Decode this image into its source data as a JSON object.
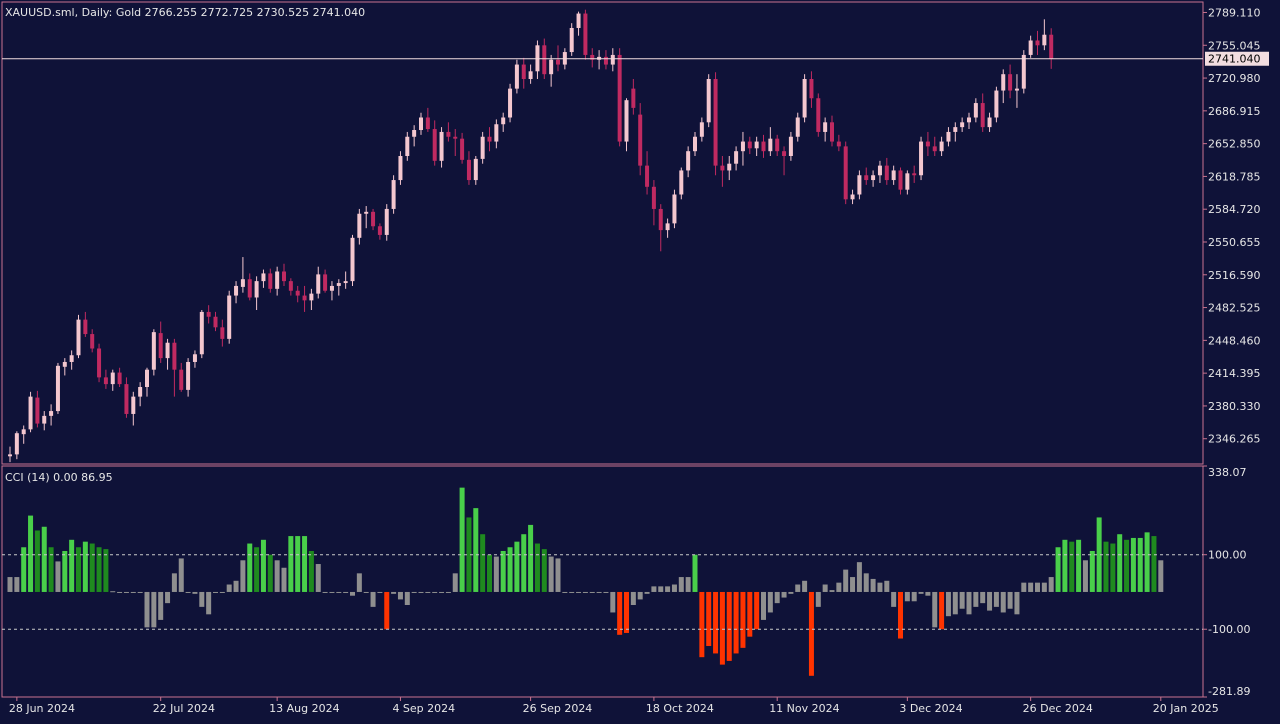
{
  "colors": {
    "background": "#0f1238",
    "border": "#c8738f",
    "bull_candle": "#f4c7cf",
    "bear_candle": "#c02a61",
    "price_line": "#f2dde0",
    "cci_strong_up": "#1f8a1f",
    "cci_up": "#49cf4a",
    "cci_neutral": "#8f8f8f",
    "cci_down": "#ff3300"
  },
  "chart_data": [
    {
      "type": "candlestick",
      "title": "XAUUSD.sml, Daily:  Gold  2766.255 2772.725 2730.525 2741.040",
      "last_price_label": "2741.040",
      "last_price": 2741.04,
      "ylim": [
        2320.0,
        2800.0
      ],
      "y_ticks": [
        "2789.110",
        "2755.045",
        "2720.980",
        "2686.915",
        "2652.850",
        "2618.785",
        "2584.720",
        "2550.655",
        "2516.590",
        "2482.525",
        "2448.460",
        "2414.395",
        "2380.330",
        "2346.265"
      ],
      "candles": [
        [
          2328.0,
          2338.0,
          2322.0,
          2330.0
        ],
        [
          2330.0,
          2354.0,
          2325.0,
          2352.0
        ],
        [
          2351.0,
          2360.0,
          2341.0,
          2356.0
        ],
        [
          2356.0,
          2395.0,
          2353.0,
          2390.0
        ],
        [
          2389.0,
          2396.0,
          2358.0,
          2362.0
        ],
        [
          2362.0,
          2375.0,
          2355.0,
          2370.0
        ],
        [
          2370.0,
          2382.0,
          2360.0,
          2375.0
        ],
        [
          2375.0,
          2425.0,
          2372.0,
          2422.0
        ],
        [
          2421.0,
          2430.0,
          2412.0,
          2426.0
        ],
        [
          2426.0,
          2438.0,
          2418.0,
          2433.0
        ],
        [
          2433.0,
          2475.0,
          2430.0,
          2470.0
        ],
        [
          2470.0,
          2478.0,
          2452.0,
          2455.0
        ],
        [
          2455.0,
          2460.0,
          2436.0,
          2440.0
        ],
        [
          2440.0,
          2445.0,
          2405.0,
          2410.0
        ],
        [
          2410.0,
          2418.0,
          2398.0,
          2403.0
        ],
        [
          2403.0,
          2418.0,
          2396.0,
          2415.0
        ],
        [
          2415.0,
          2420.0,
          2400.0,
          2403.0
        ],
        [
          2403.0,
          2410.0,
          2368.0,
          2372.0
        ],
        [
          2372.0,
          2395.0,
          2360.0,
          2390.0
        ],
        [
          2390.0,
          2405.0,
          2380.0,
          2400.0
        ],
        [
          2400.0,
          2420.0,
          2390.0,
          2418.0
        ],
        [
          2418.0,
          2460.0,
          2412.0,
          2457.0
        ],
        [
          2456.0,
          2468.0,
          2425.0,
          2430.0
        ],
        [
          2430.0,
          2450.0,
          2418.0,
          2446.0
        ],
        [
          2446.0,
          2450.0,
          2390.0,
          2418.0
        ],
        [
          2418.0,
          2425.0,
          2395.0,
          2397.0
        ],
        [
          2397.0,
          2430.0,
          2390.0,
          2426.0
        ],
        [
          2426.0,
          2438.0,
          2420.0,
          2434.0
        ],
        [
          2434.0,
          2480.0,
          2430.0,
          2478.0
        ],
        [
          2478.0,
          2485.0,
          2466.0,
          2473.0
        ],
        [
          2473.0,
          2478.0,
          2458.0,
          2462.0
        ],
        [
          2462.0,
          2470.0,
          2442.0,
          2450.0
        ],
        [
          2450.0,
          2500.0,
          2445.0,
          2495.0
        ],
        [
          2495.0,
          2510.0,
          2487.0,
          2505.0
        ],
        [
          2504.0,
          2535.0,
          2498.0,
          2512.0
        ],
        [
          2512.0,
          2518.0,
          2490.0,
          2493.0
        ],
        [
          2493.0,
          2515.0,
          2480.0,
          2510.0
        ],
        [
          2510.0,
          2522.0,
          2503.0,
          2518.0
        ],
        [
          2518.0,
          2523.0,
          2498.0,
          2502.0
        ],
        [
          2502.0,
          2525.0,
          2495.0,
          2520.0
        ],
        [
          2520.0,
          2528.0,
          2505.0,
          2510.0
        ],
        [
          2510.0,
          2513.0,
          2495.0,
          2500.0
        ],
        [
          2500.0,
          2505.0,
          2488.0,
          2495.0
        ],
        [
          2495.0,
          2505.0,
          2478.0,
          2490.0
        ],
        [
          2490.0,
          2502.0,
          2480.0,
          2497.0
        ],
        [
          2497.0,
          2525.0,
          2492.0,
          2517.0
        ],
        [
          2517.0,
          2522.0,
          2498.0,
          2500.0
        ],
        [
          2500.0,
          2510.0,
          2490.0,
          2505.0
        ],
        [
          2505.0,
          2512.0,
          2495.0,
          2508.0
        ],
        [
          2508.0,
          2520.0,
          2502.0,
          2510.0
        ],
        [
          2510.0,
          2558.0,
          2505.0,
          2555.0
        ],
        [
          2555.0,
          2585.0,
          2548.0,
          2580.0
        ],
        [
          2580.0,
          2588.0,
          2565.0,
          2582.0
        ],
        [
          2582.0,
          2585.0,
          2563.0,
          2567.0
        ],
        [
          2567.0,
          2570.0,
          2553.0,
          2558.0
        ],
        [
          2558.0,
          2590.0,
          2552.0,
          2585.0
        ],
        [
          2585.0,
          2620.0,
          2580.0,
          2615.0
        ],
        [
          2615.0,
          2645.0,
          2610.0,
          2640.0
        ],
        [
          2640.0,
          2665.0,
          2635.0,
          2660.0
        ],
        [
          2660.0,
          2672.0,
          2650.0,
          2667.0
        ],
        [
          2667.0,
          2685.0,
          2662.0,
          2680.0
        ],
        [
          2680.0,
          2690.0,
          2665.0,
          2668.0
        ],
        [
          2668.0,
          2677.0,
          2630.0,
          2635.0
        ],
        [
          2635.0,
          2670.0,
          2628.0,
          2665.0
        ],
        [
          2665.0,
          2675.0,
          2655.0,
          2660.0
        ],
        [
          2660.0,
          2668.0,
          2640.0,
          2658.0
        ],
        [
          2658.0,
          2664.0,
          2632.0,
          2636.0
        ],
        [
          2636.0,
          2645.0,
          2610.0,
          2615.0
        ],
        [
          2615.0,
          2640.0,
          2610.0,
          2637.0
        ],
        [
          2637.0,
          2665.0,
          2632.0,
          2660.0
        ],
        [
          2660.0,
          2670.0,
          2645.0,
          2655.0
        ],
        [
          2655.0,
          2678.0,
          2648.0,
          2673.0
        ],
        [
          2673.0,
          2685.0,
          2665.0,
          2680.0
        ],
        [
          2680.0,
          2715.0,
          2675.0,
          2710.0
        ],
        [
          2710.0,
          2740.0,
          2705.0,
          2735.0
        ],
        [
          2735.0,
          2742.0,
          2710.0,
          2720.0
        ],
        [
          2720.0,
          2735.0,
          2715.0,
          2728.0
        ],
        [
          2728.0,
          2760.0,
          2720.0,
          2755.0
        ],
        [
          2755.0,
          2762.0,
          2720.0,
          2725.0
        ],
        [
          2725.0,
          2745.0,
          2712.0,
          2740.0
        ],
        [
          2740.0,
          2755.0,
          2728.0,
          2735.0
        ],
        [
          2735.0,
          2752.0,
          2730.0,
          2748.0
        ],
        [
          2748.0,
          2778.0,
          2744.0,
          2773.0
        ],
        [
          2773.0,
          2790.0,
          2765.0,
          2788.0
        ],
        [
          2788.0,
          2792.0,
          2740.0,
          2745.0
        ],
        [
          2745.0,
          2752.0,
          2732.0,
          2740.0
        ],
        [
          2740.0,
          2750.0,
          2730.0,
          2743.0
        ],
        [
          2743.0,
          2750.0,
          2730.0,
          2735.0
        ],
        [
          2735.0,
          2752.0,
          2728.0,
          2745.0
        ],
        [
          2745.0,
          2752.0,
          2650.0,
          2655.0
        ],
        [
          2655.0,
          2700.0,
          2645.0,
          2698.0
        ],
        [
          2710.0,
          2720.0,
          2683.0,
          2690.0
        ],
        [
          2683.0,
          2695.0,
          2620.0,
          2630.0
        ],
        [
          2630.0,
          2645.0,
          2600.0,
          2608.0
        ],
        [
          2608.0,
          2615.0,
          2568.0,
          2585.0
        ],
        [
          2585.0,
          2590.0,
          2541.0,
          2563.0
        ],
        [
          2563.0,
          2575.0,
          2555.0,
          2570.0
        ],
        [
          2570.0,
          2605.0,
          2565.0,
          2600.0
        ],
        [
          2600.0,
          2628.0,
          2595.0,
          2625.0
        ],
        [
          2625.0,
          2650.0,
          2618.0,
          2645.0
        ],
        [
          2645.0,
          2665.0,
          2640.0,
          2660.0
        ],
        [
          2660.0,
          2680.0,
          2655.0,
          2675.0
        ],
        [
          2675.0,
          2725.0,
          2670.0,
          2720.0
        ],
        [
          2720.0,
          2727.0,
          2620.0,
          2630.0
        ],
        [
          2630.0,
          2640.0,
          2608.0,
          2625.0
        ],
        [
          2625.0,
          2640.0,
          2615.0,
          2632.0
        ],
        [
          2632.0,
          2650.0,
          2625.0,
          2645.0
        ],
        [
          2645.0,
          2665.0,
          2630.0,
          2655.0
        ],
        [
          2655.0,
          2660.0,
          2642.0,
          2648.0
        ],
        [
          2648.0,
          2660.0,
          2640.0,
          2655.0
        ],
        [
          2655.0,
          2662.0,
          2638.0,
          2645.0
        ],
        [
          2645.0,
          2670.0,
          2640.0,
          2658.0
        ],
        [
          2658.0,
          2662.0,
          2640.0,
          2645.0
        ],
        [
          2645.0,
          2650.0,
          2620.0,
          2640.0
        ],
        [
          2640.0,
          2665.0,
          2635.0,
          2660.0
        ],
        [
          2660.0,
          2685.0,
          2655.0,
          2680.0
        ],
        [
          2680.0,
          2725.0,
          2675.0,
          2720.0
        ],
        [
          2720.0,
          2728.0,
          2690.0,
          2700.0
        ],
        [
          2700.0,
          2705.0,
          2660.0,
          2665.0
        ],
        [
          2665.0,
          2680.0,
          2655.0,
          2675.0
        ],
        [
          2675.0,
          2682.0,
          2650.0,
          2655.0
        ],
        [
          2655.0,
          2662.0,
          2645.0,
          2650.0
        ],
        [
          2650.0,
          2655.0,
          2590.0,
          2595.0
        ],
        [
          2595.0,
          2605.0,
          2590.0,
          2600.0
        ],
        [
          2600.0,
          2625.0,
          2595.0,
          2620.0
        ],
        [
          2620.0,
          2628.0,
          2610.0,
          2615.0
        ],
        [
          2615.0,
          2625.0,
          2608.0,
          2620.0
        ],
        [
          2620.0,
          2635.0,
          2612.0,
          2630.0
        ],
        [
          2630.0,
          2638.0,
          2610.0,
          2615.0
        ],
        [
          2615.0,
          2630.0,
          2610.0,
          2625.0
        ],
        [
          2625.0,
          2628.0,
          2600.0,
          2605.0
        ],
        [
          2605.0,
          2625.0,
          2600.0,
          2622.0
        ],
        [
          2622.0,
          2630.0,
          2612.0,
          2620.0
        ],
        [
          2620.0,
          2660.0,
          2615.0,
          2655.0
        ],
        [
          2655.0,
          2665.0,
          2640.0,
          2650.0
        ],
        [
          2650.0,
          2660.0,
          2640.0,
          2645.0
        ],
        [
          2645.0,
          2660.0,
          2640.0,
          2655.0
        ],
        [
          2655.0,
          2670.0,
          2650.0,
          2665.0
        ],
        [
          2665.0,
          2675.0,
          2655.0,
          2670.0
        ],
        [
          2670.0,
          2680.0,
          2665.0,
          2675.0
        ],
        [
          2675.0,
          2685.0,
          2668.0,
          2680.0
        ],
        [
          2680.0,
          2700.0,
          2675.0,
          2695.0
        ],
        [
          2695.0,
          2705.0,
          2665.0,
          2670.0
        ],
        [
          2670.0,
          2685.0,
          2665.0,
          2680.0
        ],
        [
          2680.0,
          2712.0,
          2675.0,
          2708.0
        ],
        [
          2708.0,
          2730.0,
          2695.0,
          2725.0
        ],
        [
          2725.0,
          2735.0,
          2700.0,
          2708.0
        ],
        [
          2708.0,
          2725.0,
          2690.0,
          2710.0
        ],
        [
          2710.0,
          2750.0,
          2705.0,
          2745.0
        ],
        [
          2745.0,
          2765.0,
          2742.0,
          2760.0
        ],
        [
          2760.0,
          2770.0,
          2745.0,
          2755.0
        ],
        [
          2755.0,
          2782.0,
          2750.0,
          2766.0
        ],
        [
          2766.0,
          2772.725,
          2730.525,
          2741.04
        ]
      ]
    },
    {
      "type": "bar",
      "title": "CCI (14) 0.00 86.95",
      "ylim": [
        -281.89,
        338.07
      ],
      "y_ticks": [
        "338.07",
        "100.00",
        "-100.00",
        "-281.89"
      ],
      "levels": [
        100,
        -100
      ],
      "x_labels": [
        "28 Jun 2024",
        "22 Jul 2024",
        "13 Aug 2024",
        "4 Sep 2024",
        "26 Sep 2024",
        "18 Oct 2024",
        "11 Nov 2024",
        "3 Dec 2024",
        "26 Dec 2024",
        "20 Jan 2025"
      ],
      "x_label_bar_index": [
        1,
        22,
        39,
        57,
        76,
        94,
        112,
        131,
        149,
        168
      ],
      "values": [
        40,
        40,
        120,
        205,
        165,
        175,
        120,
        82,
        110,
        140,
        120,
        135,
        130,
        120,
        115,
        2,
        0,
        0,
        0,
        0,
        -95,
        -95,
        -75,
        -30,
        50,
        90,
        0,
        -5,
        -40,
        -60,
        0,
        0,
        20,
        30,
        85,
        130,
        120,
        140,
        100,
        85,
        65,
        150,
        150,
        150,
        110,
        75,
        0,
        0,
        0,
        0,
        -10,
        50,
        0,
        -40,
        0,
        -100,
        -5,
        -20,
        -35,
        0,
        0,
        0,
        0,
        0,
        0,
        50,
        280,
        200,
        225,
        155,
        100,
        95,
        110,
        120,
        135,
        155,
        180,
        130,
        115,
        95,
        90,
        0,
        0,
        0,
        0,
        0,
        0,
        0,
        -55,
        -115,
        -110,
        -35,
        -20,
        -5,
        15,
        15,
        15,
        20,
        40,
        40,
        100,
        -175,
        -145,
        -165,
        -195,
        -185,
        -165,
        -150,
        -120,
        -100,
        -75,
        -55,
        -30,
        -15,
        -5,
        20,
        30,
        -225,
        -40,
        20,
        5,
        25,
        60,
        40,
        80,
        50,
        35,
        25,
        30,
        -40,
        -125,
        -25,
        -25,
        -5,
        -10,
        -95,
        -100,
        -65,
        -60,
        -45,
        -60,
        -40,
        -30,
        -50,
        -40,
        -55,
        -45,
        -60,
        25,
        25,
        25,
        25,
        40,
        120,
        140,
        135,
        140,
        85,
        110,
        200,
        135,
        130,
        155,
        140,
        145,
        145,
        160,
        150,
        85
      ],
      "colors_per_bar": "derived"
    }
  ]
}
